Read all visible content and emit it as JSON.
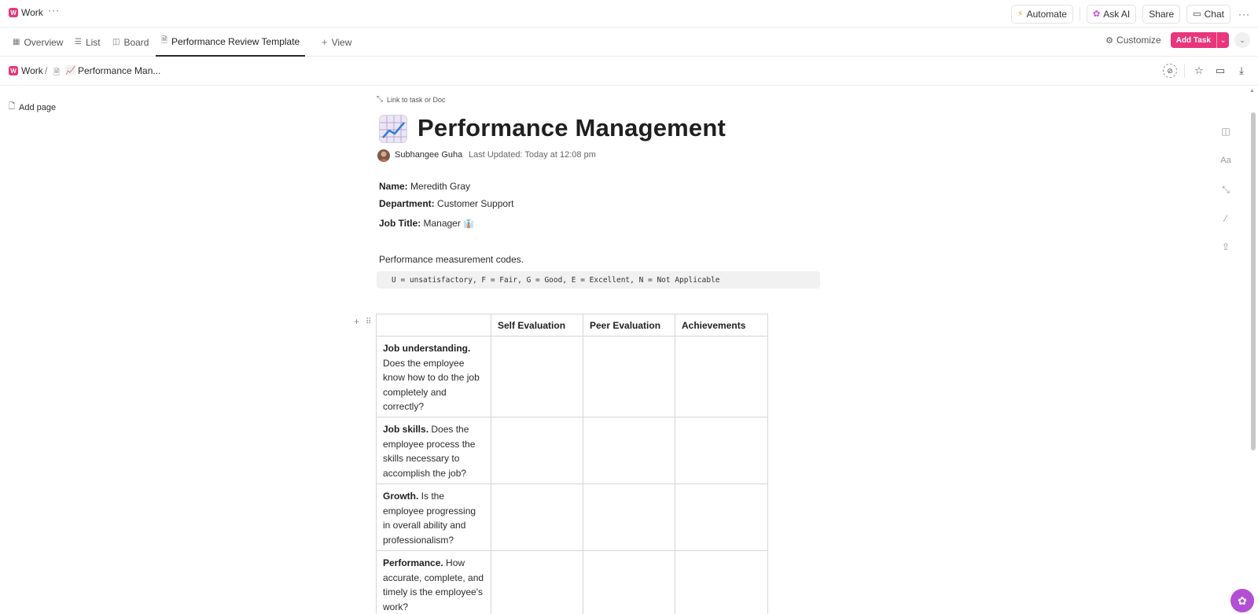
{
  "workspace": {
    "logo_letter": "W",
    "name": "Work",
    "more": "···"
  },
  "top_actions": {
    "automate": "Automate",
    "ask_ai": "Ask AI",
    "share": "Share",
    "chat": "Chat",
    "more": "···"
  },
  "tabs": [
    {
      "label": "Overview",
      "icon": "overview-icon"
    },
    {
      "label": "List",
      "icon": "list-icon"
    },
    {
      "label": "Board",
      "icon": "board-icon"
    },
    {
      "label": "Performance Review Template",
      "icon": "doc-lock-icon",
      "active": true
    },
    {
      "label": "View",
      "icon": "plus-icon"
    }
  ],
  "tab_actions": {
    "customize": "Customize",
    "add_task": "Add Task"
  },
  "breadcrumb": {
    "workspace": "Work",
    "separator": "/",
    "page": "Performance Man..."
  },
  "sidebar": {
    "add_page": "Add page"
  },
  "doc": {
    "link_task": "Link to task or Doc",
    "title": "Performance Management",
    "author": "Subhangee Guha",
    "last_updated": "Last Updated: Today at 12:08 pm",
    "fields": [
      {
        "label": "Name:",
        "value": "Meredith Gray"
      },
      {
        "label": "Department:",
        "value": "Customer Support"
      },
      {
        "label": "Job Title:",
        "value": "Manager"
      }
    ],
    "codes_intro": "Performance measurement codes.",
    "codes": "U = unsatisfactory, F = Fair, G = Good, E = Excellent, N = Not Applicable",
    "table": {
      "headers": [
        "",
        "Self Evaluation",
        "Peer Evaluation",
        "Achievements"
      ],
      "rows": [
        {
          "title": "Job understanding.",
          "text": "Does the employee know how to do the job completely and correctly?"
        },
        {
          "title": "Job skills.",
          "text": "Does the employee process the skills necessary to accomplish the job?"
        },
        {
          "title": "Growth.",
          "text": "Is the employee progressing in overall ability and professionalism?"
        },
        {
          "title": "Performance.",
          "text": "How accurate, complete, and timely is the employee's work?"
        }
      ]
    }
  },
  "colors": {
    "brand": "#e8357b",
    "fab": "#b34fd4"
  }
}
